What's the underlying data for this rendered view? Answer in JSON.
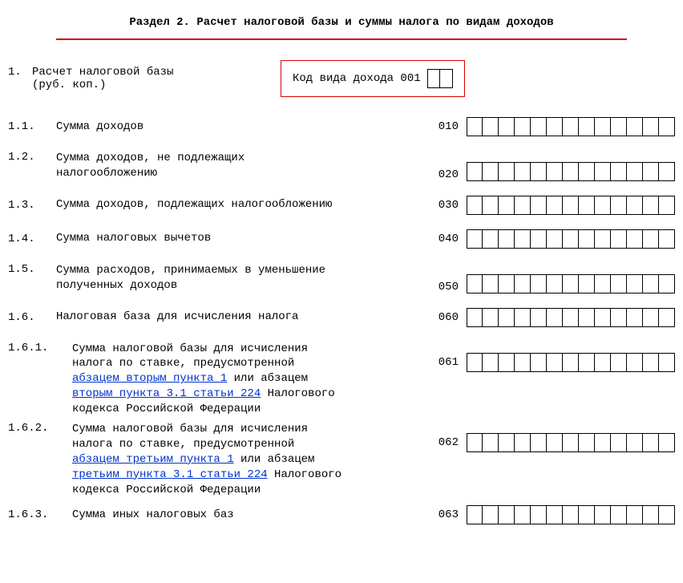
{
  "title": "Раздел 2. Расчет налоговой базы и суммы налога по видам доходов",
  "header": {
    "num": "1.",
    "label_l1": "Расчет налоговой базы",
    "label_l2": "(руб. коп.)",
    "redbox_label": "Код вида дохода 001"
  },
  "rows": [
    {
      "num": "1.1.",
      "label": "Сумма доходов",
      "code": "010",
      "cells": 13
    },
    {
      "num": "1.2.",
      "label_l1": "Сумма доходов, не подлежащих",
      "label_l2": "налогообложению",
      "code": "020",
      "cells": 13
    },
    {
      "num": "1.3.",
      "label": "Сумма доходов, подлежащих налогообложению",
      "code": "030",
      "cells": 13
    },
    {
      "num": "1.4.",
      "label": "Сумма налоговых вычетов",
      "code": "040",
      "cells": 13
    },
    {
      "num": "1.5.",
      "label_l1": "Сумма расходов, принимаемых в уменьшение",
      "label_l2": "полученных доходов",
      "code": "050",
      "cells": 13
    },
    {
      "num": "1.6.",
      "label": "Налоговая база для исчисления налога",
      "code": "060",
      "cells": 13
    }
  ],
  "row161": {
    "num": "1.6.1.",
    "t1": "Сумма налоговой базы для исчисления",
    "t2": "налога по ставке, предусмотренной",
    "link1": "абзацем вторым пункта 1",
    "t3": " или абзацем",
    "link2": "вторым пункта 3.1 статьи 224",
    "t4": " Налогового",
    "t5": "кодекса Российской Федерации",
    "code": "061",
    "cells": 13
  },
  "row162": {
    "num": "1.6.2.",
    "t1": "Сумма налоговой базы для исчисления",
    "t2": "налога по ставке, предусмотренной",
    "link1": "абзацем третьим пункта 1",
    "t3": " или абзацем",
    "link2": "третьим пункта 3.1 статьи 224",
    "t4": " Налогового",
    "t5": "кодекса Российской Федерации",
    "code": "062",
    "cells": 13
  },
  "row163": {
    "num": "1.6.3.",
    "label": "Сумма иных налоговых баз",
    "code": "063",
    "cells": 13
  }
}
